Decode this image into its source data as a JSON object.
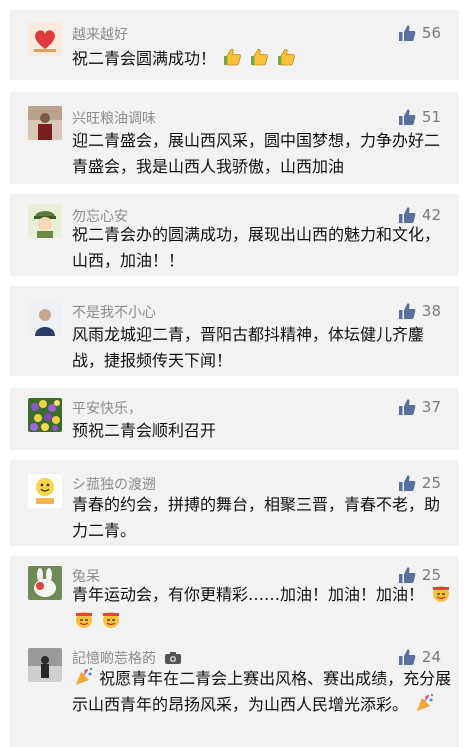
{
  "comments": [
    {
      "name": "越来越好",
      "likes": "56",
      "text": "祝二青会圆满成功！"
    },
    {
      "name": "兴旺粮油调味",
      "likes": "51",
      "text": "迎二青盛会，展山西风采，圆中国梦想，力争办好二青盛会，我是山西人我骄傲，山西加油"
    },
    {
      "name": "勿忘心安",
      "likes": "42",
      "text": "祝二青会办的圆满成功，展现出山西的魅力和文化，山西，加油！！"
    },
    {
      "name": "不是我不小心",
      "likes": "38",
      "text": "风雨龙城迎二青，晋阳古都抖精神，体坛健儿齐鏖战，捷报频传天下闻！"
    },
    {
      "name": "平安快乐，",
      "likes": "37",
      "text": "预祝二青会顺利召开"
    },
    {
      "name": "シ菰独の渡遡",
      "likes": "25",
      "text": "青春的约会，拼搏的舞台，相聚三晋，青春不老，助力二青。"
    },
    {
      "name": "兔呆",
      "likes": "25",
      "text": "青年运动会，有你更精彩……加油！加油！加油！"
    },
    {
      "name": "記憶啲莣格菂",
      "likes": "24",
      "text": "祝愿青年在二青会上赛出风格、赛出成绩，充分展示山西青年的昂扬风采，为山西人民增光添彩。"
    }
  ],
  "icons": {
    "like": "thumbs-up-icon",
    "camera": "camera-icon",
    "thumbs_emoji": "thumbs-up-emoji",
    "party": "party-popper-emoji",
    "cheer": "cheering-face-emoji"
  },
  "colors": {
    "card_bg": "#f2f2f2",
    "name": "#8d8d8d",
    "like": "#56709e"
  }
}
